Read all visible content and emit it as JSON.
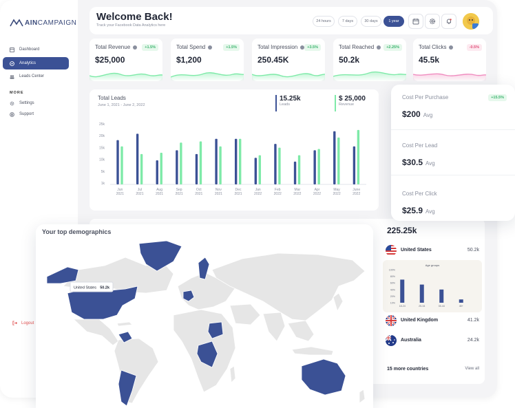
{
  "colors": {
    "primary": "#3b5195",
    "accent_green": "#7eeaa8",
    "pink": "#f7a8cf"
  },
  "brand": {
    "name_bold": "AIN",
    "name_rest": "CAMPAIGN"
  },
  "sidebar": {
    "items": [
      {
        "label": "Dashboard",
        "icon": "dashboard-icon"
      },
      {
        "label": "Analytics",
        "icon": "analytics-icon",
        "active": true
      },
      {
        "label": "Leads Center",
        "icon": "leads-icon"
      }
    ],
    "more_label": "MORE",
    "more_items": [
      {
        "label": "Settings",
        "icon": "gear-icon"
      },
      {
        "label": "Support",
        "icon": "support-icon"
      }
    ],
    "logout_label": "Logout"
  },
  "header": {
    "title": "Welcome Back!",
    "subtitle": "Track your Facebook Data Analytics here",
    "ranges": [
      "24 hours",
      "7 days",
      "30 days",
      "1 year"
    ],
    "active_range": "1 year"
  },
  "stats": [
    {
      "label": "Total Revenue",
      "value": "$25,000",
      "badge": "+1.5%",
      "trend": "up"
    },
    {
      "label": "Total Spend",
      "value": "$1,200",
      "badge": "+1.5%",
      "trend": "up"
    },
    {
      "label": "Total Impression",
      "value": "250.45K",
      "badge": "+3.5%",
      "trend": "up"
    },
    {
      "label": "Total Reached",
      "value": "50.2k",
      "badge": "+2.25%",
      "trend": "up"
    },
    {
      "label": "Total Clicks",
      "value": "45.5k",
      "badge": "-0.5%",
      "trend": "down"
    }
  ],
  "leads_chart": {
    "title": "Total Leads",
    "date_range": "June 1, 2021 - June 2, 2022",
    "leads_value": "15.25k",
    "leads_label": "Leads",
    "revenue_value": "$ 25,000",
    "revenue_label": "Revenue"
  },
  "chart_data": {
    "type": "bar",
    "categories": [
      "Jun 2021",
      "Jul 2021",
      "Aug 2021",
      "Sep 2021",
      "Oct 2021",
      "Nov 2021",
      "Dec 2021",
      "Jan 2022",
      "Feb 2022",
      "Mar 2022",
      "Apr 2022",
      "May 2022",
      "June 2022"
    ],
    "yticks": [
      "25k",
      "20k",
      "15k",
      "10k",
      "5k",
      "1k"
    ],
    "ylim": [
      0,
      25000
    ],
    "series": [
      {
        "name": "Leads",
        "color": "#3b5195",
        "values": [
          17500,
          20000,
          9500,
          13500,
          12000,
          18000,
          18000,
          10500,
          16000,
          9000,
          13500,
          21000,
          15000
        ]
      },
      {
        "name": "Revenue",
        "color": "#7eeaa8",
        "values": [
          15000,
          12000,
          12500,
          16500,
          17000,
          15000,
          18000,
          11500,
          14500,
          11500,
          14000,
          18500,
          21500
        ]
      }
    ]
  },
  "costs": [
    {
      "label": "Cost Per Purchase",
      "value": "$200",
      "unit": "Avg",
      "badge": "+15.5%"
    },
    {
      "label": "Cost Per Lead",
      "value": "$30.5",
      "unit": "Avg"
    },
    {
      "label": "Cost Per Click",
      "value": "$25.9",
      "unit": "Avg"
    }
  ],
  "demographics": {
    "title": "Your top demographics",
    "tooltip_country": "United States",
    "tooltip_value": "50.2k"
  },
  "countries": {
    "total": "225.25k",
    "list": [
      {
        "name": "United States",
        "value": "50.2k",
        "flag": "us-flag-icon"
      },
      {
        "name": "United Kingdom",
        "value": "41.2k",
        "flag": "uk-flag-icon"
      },
      {
        "name": "Australia",
        "value": "24.2k",
        "flag": "au-flag-icon"
      }
    ],
    "age_title": "Age groups",
    "age_yticks": [
      "100%",
      "80%",
      "60%",
      "40%",
      "20%",
      "10%"
    ],
    "age_groups": [
      {
        "label": "18-24",
        "value": 70
      },
      {
        "label": "25-34",
        "value": 55
      },
      {
        "label": "35-44",
        "value": 40
      },
      {
        "label": "45+",
        "value": 10
      }
    ],
    "more_label": "15 more countries",
    "view_all": "View all"
  }
}
